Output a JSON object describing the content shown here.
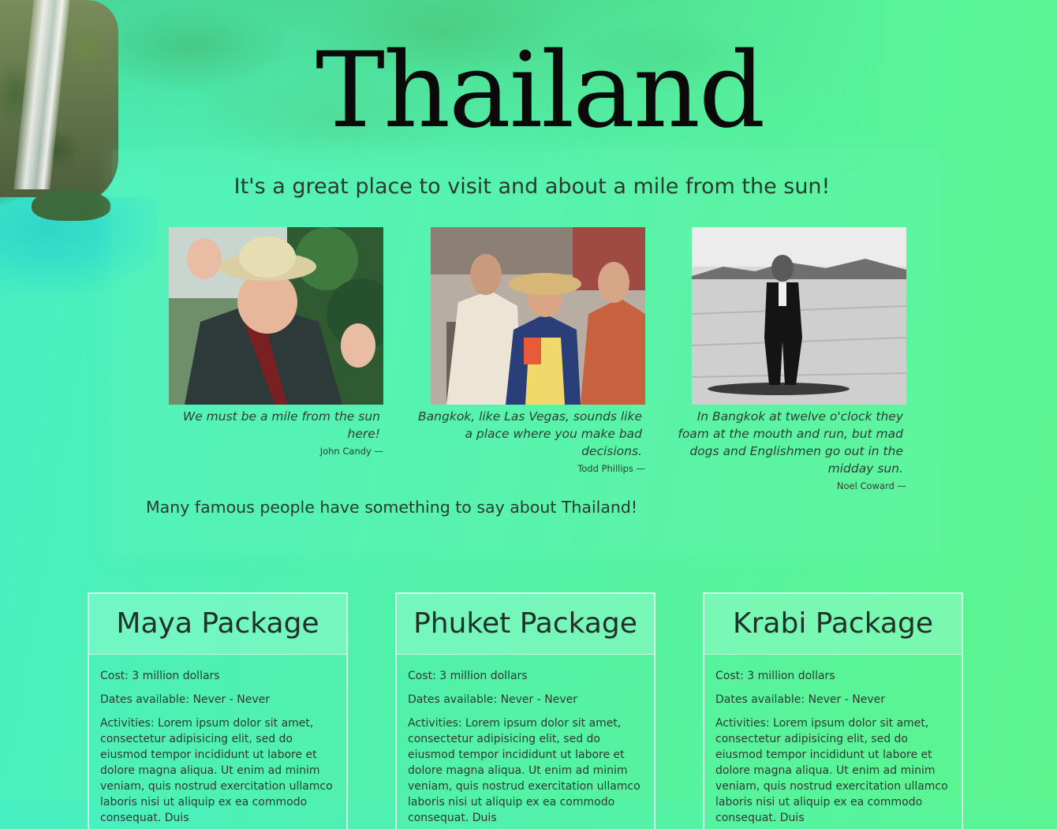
{
  "page": {
    "title": "Thailand",
    "tagline": "It's a great place to visit and about a mile from the sun!",
    "famous_note": "Many famous people have something to say about Thailand!"
  },
  "quotes": [
    {
      "text": "We must be a mile from the sun here!",
      "author": "John Candy —",
      "image": "photo-man-in-pith-helmet"
    },
    {
      "text": "Bangkok, like Las Vegas, sounds like a place where you make bad decisions.",
      "author": "Todd Phillips —",
      "image": "photo-three-men-street"
    },
    {
      "text": "In Bangkok at twelve o'clock they foam at the mouth and run, but mad dogs and Englishmen go out in the midday sun.",
      "author": "Noel Coward —",
      "image": "photo-man-in-desert"
    }
  ],
  "packages": [
    {
      "title": "Maya Package",
      "cost": "Cost: 3 million dollars",
      "dates": "Dates available: Never - Never",
      "activities": "Activities: Lorem ipsum dolor sit amet, consectetur adipisicing elit, sed do eiusmod tempor incididunt ut labore et dolore magna aliqua. Ut enim ad minim veniam, quis nostrud exercitation ullamco laboris nisi ut aliquip ex ea commodo consequat. Duis"
    },
    {
      "title": "Phuket Package",
      "cost": "Cost: 3 million dollars",
      "dates": "Dates available: Never - Never",
      "activities": "Activities: Lorem ipsum dolor sit amet, consectetur adipisicing elit, sed do eiusmod tempor incididunt ut labore et dolore magna aliqua. Ut enim ad minim veniam, quis nostrud exercitation ullamco laboris nisi ut aliquip ex ea commodo consequat. Duis"
    },
    {
      "title": "Krabi Package",
      "cost": "Cost: 3 million dollars",
      "dates": "Dates available: Never - Never",
      "activities": "Activities: Lorem ipsum dolor sit amet, consectetur adipisicing elit, sed do eiusmod tempor incididunt ut labore et dolore magna aliqua. Ut enim ad minim veniam, quis nostrud exercitation ullamco laboris nisi ut aliquip ex ea commodo consequat. Duis"
    }
  ],
  "colors": {
    "background_start": "#48efc2",
    "background_end": "#5cf58e",
    "title_text": "#0a0a0a",
    "body_text": "#2a3a30"
  }
}
